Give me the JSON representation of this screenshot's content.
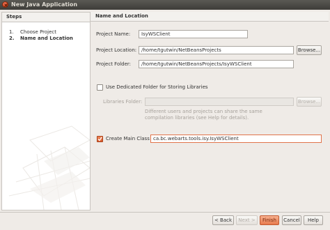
{
  "window": {
    "title": "New Java Application"
  },
  "steps": {
    "header": "Steps",
    "items": [
      {
        "num": "1.",
        "label": "Choose Project"
      },
      {
        "num": "2.",
        "label": "Name and Location"
      }
    ]
  },
  "panel": {
    "header": "Name and Location",
    "project_name": {
      "label": "Project Name:",
      "value": "IsyWSClient"
    },
    "project_location": {
      "label": "Project Location:",
      "value": "/home/tgutwin/NetBeansProjects",
      "browse": "Browse..."
    },
    "project_folder": {
      "label": "Project Folder:",
      "value": "/home/tgutwin/NetBeansProjects/IsyWSClient"
    },
    "dedicated_folder": {
      "label": "Use Dedicated Folder for Storing Libraries",
      "checked": false
    },
    "libraries_folder": {
      "label": "Libraries Folder:",
      "value": "",
      "browse": "Browse...",
      "hint": "Different users and projects can share the same compilation libraries (see Help for details)."
    },
    "main_class": {
      "label": "Create Main Class",
      "checked": true,
      "value": "ca.bc.webarts.tools.isy.IsyWSClient"
    }
  },
  "buttons": {
    "back": "< Back",
    "next": "Next >",
    "finish": "Finish",
    "cancel": "Cancel",
    "help": "Help"
  },
  "colors": {
    "accent": "#e77a4d",
    "titlebar": "#3e3d39",
    "dialog_bg": "#efebe7"
  }
}
